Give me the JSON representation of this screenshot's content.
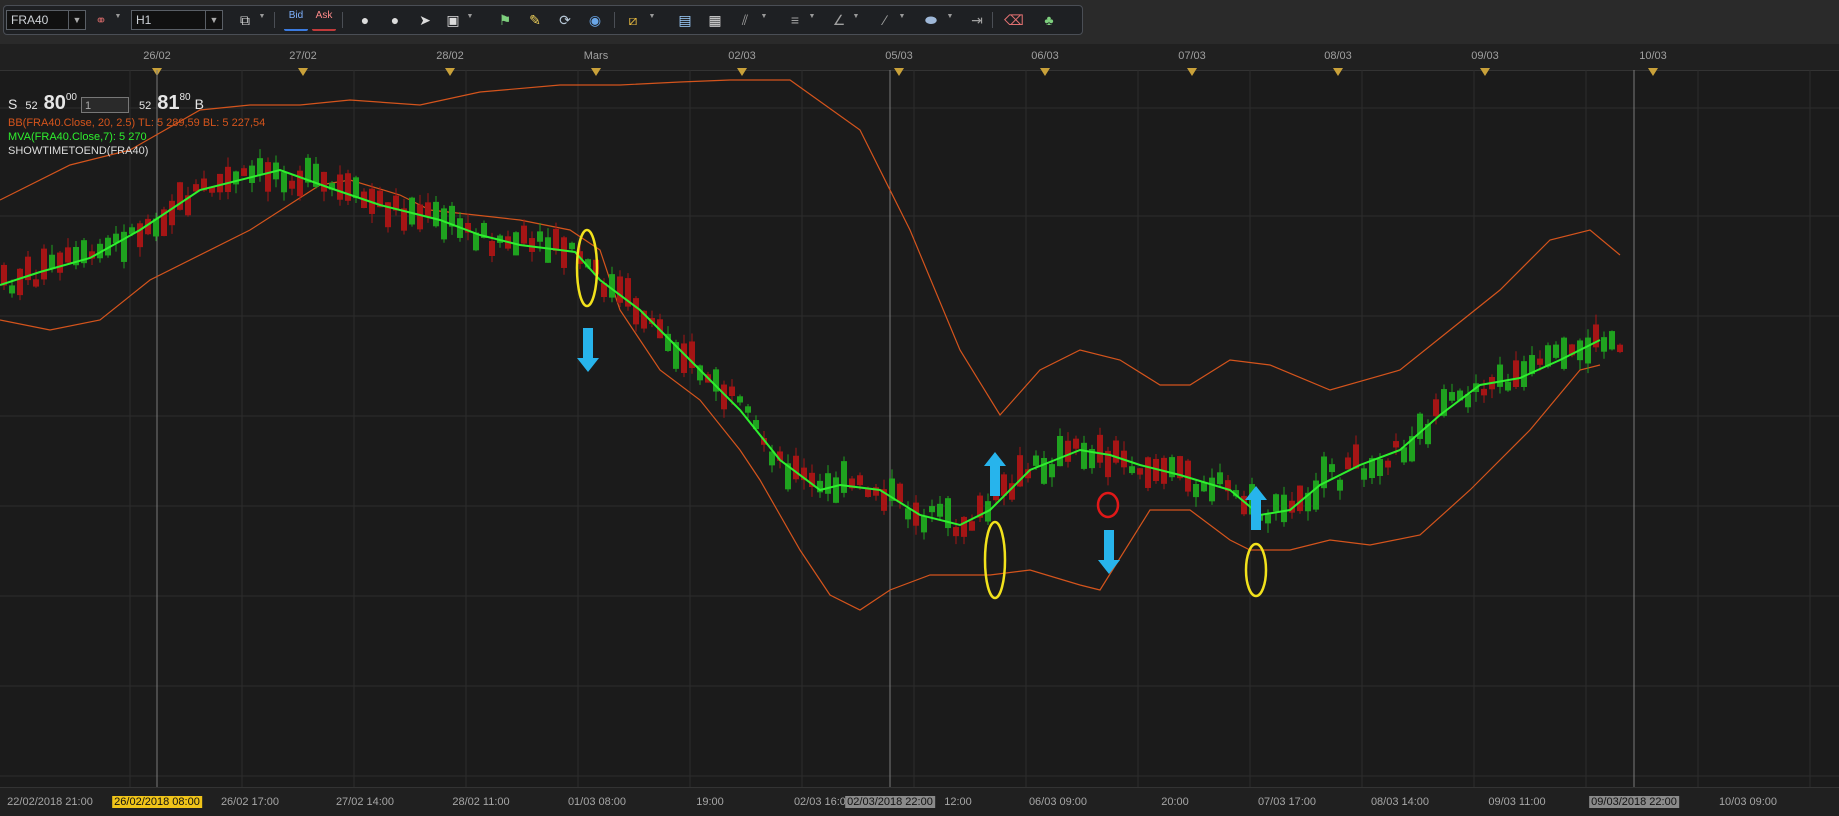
{
  "toolbar": {
    "instrument": "FRA40",
    "timeframe": "H1",
    "bid_label": "Bid",
    "ask_label": "Ask",
    "icons": [
      "link-icon",
      "chart-type-icon",
      "profile-icon",
      "profile-add-icon",
      "cursor-icon",
      "frame-icon",
      "flag-icon",
      "note-icon",
      "refresh-icon",
      "globe-icon",
      "ruler-icon",
      "image-icon",
      "window-icon",
      "trend-lines-icon",
      "list-icon",
      "pen-icon",
      "brush-icon",
      "shape-icon",
      "indent-icon",
      "eraser-icon",
      "tree-icon"
    ]
  },
  "top_dates": [
    "26/02",
    "27/02",
    "28/02",
    "Mars",
    "02/03",
    "05/03",
    "06/03",
    "07/03",
    "08/03",
    "09/03",
    "10/03"
  ],
  "quote": {
    "sell_label": "S",
    "sell_small": "52",
    "sell_big": "80",
    "sell_sup": "00",
    "qty": "1",
    "buy_small": "52",
    "buy_big": "81",
    "buy_sup": "80",
    "buy_label": "B"
  },
  "legend": {
    "bb": "BB(FRA40.Close, 20, 2.5)  TL: 5 289,59  BL: 5 227,54",
    "mva": "MVA(FRA40.Close,7): 5 270",
    "showtime": "SHOWTIMETOEND(FRA40)"
  },
  "colors": {
    "background": "#1b1b1b",
    "up_candle": "#1fa21f",
    "down_candle": "#a51515",
    "moving_average": "#2ef02e",
    "bollinger": "#d4541c",
    "annotation_circle": "#f2e21c",
    "annotation_circle_red": "#e01818",
    "arrow": "#27b4ec",
    "current_time_highlight": "#f0c419"
  },
  "bottom_times": [
    {
      "label": "22/02/2018 21:00",
      "hl": ""
    },
    {
      "label": "26/02/2018 08:00",
      "hl": "yellow"
    },
    {
      "label": "26/02 17:00",
      "hl": ""
    },
    {
      "label": "27/02 14:00",
      "hl": ""
    },
    {
      "label": "28/02 11:00",
      "hl": ""
    },
    {
      "label": "01/03 08:00",
      "hl": ""
    },
    {
      "label": "19:00",
      "hl": ""
    },
    {
      "label": "02/03 16:00",
      "hl": ""
    },
    {
      "label": "02/03/2018 22:00",
      "hl": "gray"
    },
    {
      "label": "12:00",
      "hl": ""
    },
    {
      "label": "06/03 09:00",
      "hl": ""
    },
    {
      "label": "20:00",
      "hl": ""
    },
    {
      "label": "07/03 17:00",
      "hl": ""
    },
    {
      "label": "08/03 14:00",
      "hl": ""
    },
    {
      "label": "09/03 11:00",
      "hl": ""
    },
    {
      "label": "09/03/2018 22:00",
      "hl": "gray"
    },
    {
      "label": "10/03 09:00",
      "hl": ""
    }
  ],
  "chart_data": {
    "type": "candlestick",
    "instrument": "FRA40",
    "timeframe": "H1",
    "indicators": [
      "BB(FRA40.Close, 20, 2.5)",
      "MVA(FRA40.Close,7)",
      "SHOWTIMETOEND(FRA40)"
    ],
    "ma_path": [
      [
        0,
        215
      ],
      [
        40,
        202
      ],
      [
        90,
        188
      ],
      [
        140,
        160
      ],
      [
        200,
        120
      ],
      [
        280,
        100
      ],
      [
        330,
        118
      ],
      [
        380,
        135
      ],
      [
        440,
        150
      ],
      [
        480,
        165
      ],
      [
        520,
        175
      ],
      [
        560,
        180
      ],
      [
        575,
        182
      ],
      [
        600,
        210
      ],
      [
        640,
        240
      ],
      [
        680,
        280
      ],
      [
        700,
        300
      ],
      [
        740,
        340
      ],
      [
        780,
        390
      ],
      [
        820,
        420
      ],
      [
        840,
        415
      ],
      [
        880,
        420
      ],
      [
        920,
        445
      ],
      [
        960,
        455
      ],
      [
        990,
        440
      ],
      [
        1030,
        400
      ],
      [
        1080,
        380
      ],
      [
        1110,
        385
      ],
      [
        1140,
        395
      ],
      [
        1180,
        405
      ],
      [
        1230,
        420
      ],
      [
        1260,
        445
      ],
      [
        1290,
        440
      ],
      [
        1320,
        415
      ],
      [
        1360,
        395
      ],
      [
        1400,
        380
      ],
      [
        1440,
        345
      ],
      [
        1480,
        315
      ],
      [
        1520,
        308
      ],
      [
        1560,
        290
      ],
      [
        1600,
        270
      ]
    ],
    "bb_upper": [
      [
        0,
        130
      ],
      [
        70,
        95
      ],
      [
        130,
        80
      ],
      [
        200,
        40
      ],
      [
        250,
        35
      ],
      [
        300,
        35
      ],
      [
        350,
        30
      ],
      [
        420,
        35
      ],
      [
        480,
        22
      ],
      [
        560,
        15
      ],
      [
        620,
        15
      ],
      [
        680,
        12
      ],
      [
        730,
        10
      ],
      [
        790,
        10
      ],
      [
        860,
        60
      ],
      [
        910,
        160
      ],
      [
        960,
        280
      ],
      [
        1000,
        345
      ],
      [
        1040,
        300
      ],
      [
        1080,
        280
      ],
      [
        1120,
        290
      ],
      [
        1160,
        315
      ],
      [
        1190,
        315
      ],
      [
        1230,
        290
      ],
      [
        1270,
        295
      ],
      [
        1330,
        320
      ],
      [
        1400,
        300
      ],
      [
        1450,
        260
      ],
      [
        1500,
        220
      ],
      [
        1550,
        170
      ],
      [
        1590,
        160
      ],
      [
        1620,
        185
      ]
    ],
    "bb_lower": [
      [
        0,
        250
      ],
      [
        50,
        260
      ],
      [
        100,
        250
      ],
      [
        150,
        210
      ],
      [
        250,
        160
      ],
      [
        320,
        115
      ],
      [
        350,
        110
      ],
      [
        400,
        125
      ],
      [
        430,
        140
      ],
      [
        520,
        150
      ],
      [
        570,
        160
      ],
      [
        600,
        180
      ],
      [
        620,
        240
      ],
      [
        660,
        300
      ],
      [
        700,
        330
      ],
      [
        740,
        380
      ],
      [
        760,
        410
      ],
      [
        800,
        480
      ],
      [
        830,
        525
      ],
      [
        860,
        540
      ],
      [
        890,
        520
      ],
      [
        930,
        505
      ],
      [
        990,
        505
      ],
      [
        1030,
        500
      ],
      [
        1080,
        515
      ],
      [
        1100,
        520
      ],
      [
        1150,
        440
      ],
      [
        1190,
        440
      ],
      [
        1230,
        470
      ],
      [
        1250,
        480
      ],
      [
        1290,
        480
      ],
      [
        1330,
        470
      ],
      [
        1370,
        475
      ],
      [
        1420,
        465
      ],
      [
        1470,
        420
      ],
      [
        1530,
        360
      ],
      [
        1580,
        300
      ],
      [
        1600,
        295
      ]
    ],
    "vertical_markers": [
      "26/02/2018 08:00",
      "02/03/2018 22:00",
      "09/03/2018 22:00"
    ],
    "annotations": [
      {
        "shape": "ellipse",
        "color": "yellow",
        "near": "01/03 08:00"
      },
      {
        "shape": "arrow-down",
        "color": "blue",
        "near": "01/03 08:00"
      },
      {
        "shape": "ellipse",
        "color": "yellow",
        "near": "06/03 09:00"
      },
      {
        "shape": "arrow-up",
        "color": "blue",
        "near": "06/03 09:00"
      },
      {
        "shape": "ellipse",
        "color": "red",
        "near": "06/03 20:00"
      },
      {
        "shape": "arrow-down",
        "color": "blue",
        "near": "06/03 20:00"
      },
      {
        "shape": "ellipse",
        "color": "yellow",
        "near": "07/03 17:00"
      },
      {
        "shape": "arrow-up",
        "color": "blue",
        "near": "07/03 17:00"
      }
    ]
  }
}
